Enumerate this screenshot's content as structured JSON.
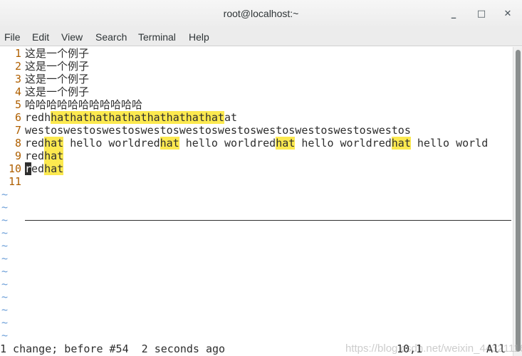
{
  "window": {
    "title": "root@localhost:~",
    "minimize_icon": "_",
    "maximize_icon": "□",
    "close_icon": "✕"
  },
  "menu": [
    "File",
    "Edit",
    "View",
    "Search",
    "Terminal",
    "Help"
  ],
  "colors": {
    "highlight": "#fce94f",
    "line_number": "#af5f00",
    "tilde": "#6c9fd8"
  },
  "lines": [
    {
      "n": "1",
      "segs": [
        [
          "这是一个例子",
          0
        ]
      ]
    },
    {
      "n": "2",
      "segs": [
        [
          "这是一个例子",
          0
        ]
      ]
    },
    {
      "n": "3",
      "segs": [
        [
          "这是一个例子",
          0
        ]
      ]
    },
    {
      "n": "4",
      "segs": [
        [
          "这是一个例子",
          0
        ]
      ]
    },
    {
      "n": "5",
      "segs": [
        [
          "哈哈哈哈哈哈哈哈哈哈哈",
          0
        ]
      ]
    },
    {
      "n": "6",
      "segs": [
        [
          "redh",
          0
        ],
        [
          "hathathathathathathathathat",
          1
        ],
        [
          "at",
          0
        ]
      ]
    },
    {
      "n": "7",
      "segs": [
        [
          "westoswestoswestoswestoswestoswestoswestoswestoswestoswestos",
          0
        ]
      ]
    },
    {
      "n": "8",
      "segs": [
        [
          "red",
          0
        ],
        [
          "hat",
          1
        ],
        [
          " hello worldred",
          0
        ],
        [
          "hat",
          1
        ],
        [
          " hello worldred",
          0
        ],
        [
          "hat",
          1
        ],
        [
          " hello worldred",
          0
        ],
        [
          "hat",
          1
        ],
        [
          " hello world",
          0
        ]
      ]
    },
    {
      "n": "9",
      "segs": [
        [
          "red",
          0
        ],
        [
          "hat",
          1
        ]
      ]
    },
    {
      "n": "10",
      "segs": [
        [
          "r",
          2
        ],
        [
          "ed",
          0
        ],
        [
          "hat",
          1
        ]
      ]
    },
    {
      "n": "11",
      "segs": []
    }
  ],
  "tilde": "~",
  "status": {
    "message": "1 change; before #54  2 seconds ago",
    "position": "10,1",
    "scroll": "All"
  },
  "watermark": "https://blog.csdn.net/weixin_44321116"
}
